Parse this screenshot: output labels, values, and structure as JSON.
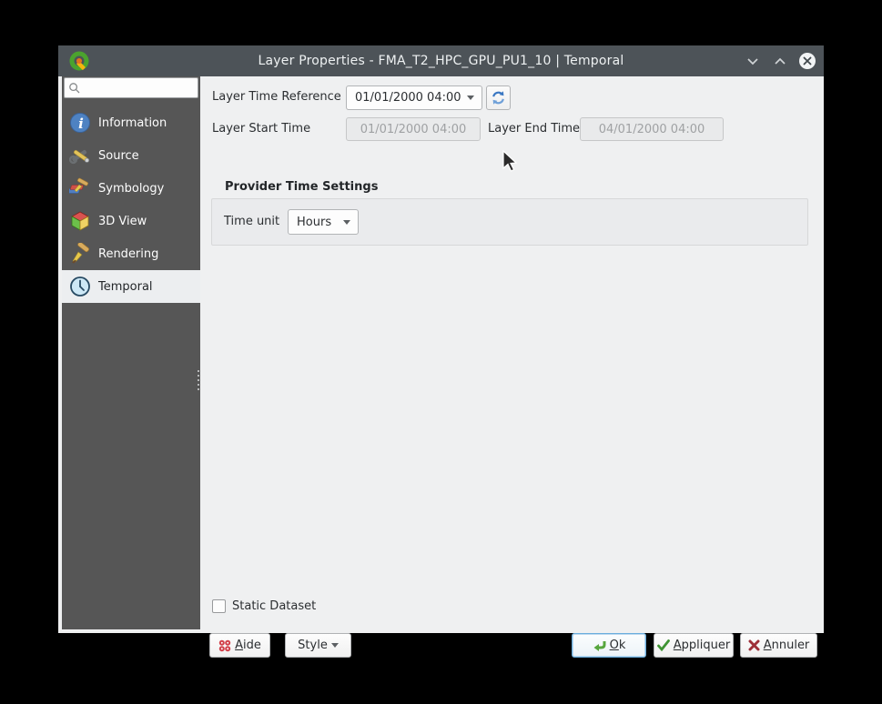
{
  "window": {
    "title": "Layer Properties - FMA_T2_HPC_GPU_PU1_10 | Temporal"
  },
  "sidebar": {
    "search": {
      "value": "",
      "placeholder": ""
    },
    "items": [
      {
        "label": "Information",
        "icon": "info-icon",
        "selected": false
      },
      {
        "label": "Source",
        "icon": "source-icon",
        "selected": false
      },
      {
        "label": "Symbology",
        "icon": "symbology-icon",
        "selected": false
      },
      {
        "label": "3D View",
        "icon": "cube-3d-icon",
        "selected": false
      },
      {
        "label": "Rendering",
        "icon": "paintbrush-icon",
        "selected": false
      },
      {
        "label": "Temporal",
        "icon": "clock-icon",
        "selected": true
      }
    ]
  },
  "main": {
    "layer_time_reference": {
      "label": "Layer Time Reference",
      "value": "01/01/2000 04:00"
    },
    "layer_start_time": {
      "label": "Layer Start Time",
      "value": "01/01/2000 04:00",
      "disabled": true
    },
    "layer_end_time": {
      "label": "Layer End Time",
      "value": "04/01/2000 04:00",
      "disabled": true
    },
    "provider_time_settings": {
      "title": "Provider Time Settings",
      "time_unit": {
        "label": "Time unit",
        "value": "Hours"
      }
    },
    "static_dataset": {
      "label": "Static Dataset",
      "checked": false
    }
  },
  "footer": {
    "help_label": "Aide",
    "style_label": "Style",
    "ok_label": "Ok",
    "apply_label": "Appliquer",
    "cancel_label": "Annuler"
  },
  "colors": {
    "titlebar": "#4d5358",
    "sidebar": "#565656",
    "selection_bg": "#eceef0",
    "panel_bg": "#eff0f1",
    "default_button_border": "#6aaede",
    "ok_icon_green": "#57a63e",
    "cancel_icon_red": "#9e3039",
    "help_icon_red": "#d2404a",
    "refresh_icon_blue": "#3a77c2"
  }
}
